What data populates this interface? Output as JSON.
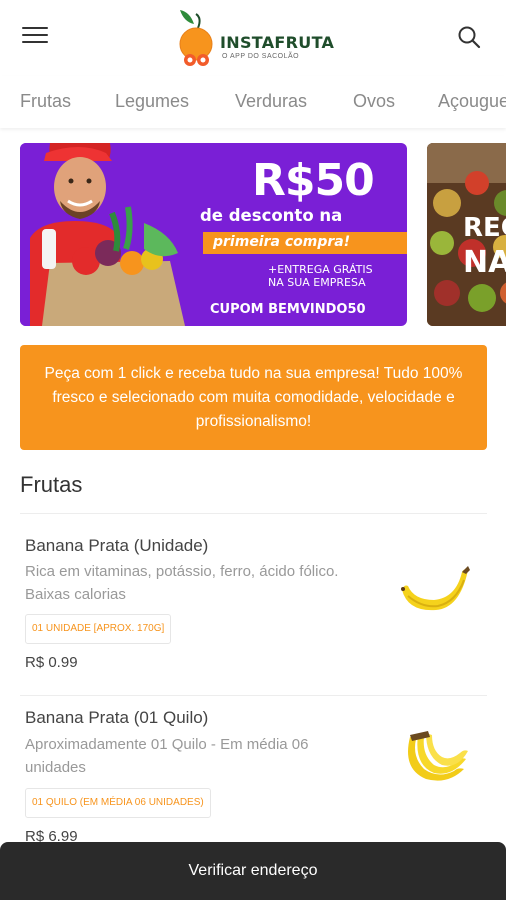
{
  "header": {
    "logo_name": "INSTAFRUTA",
    "logo_tagline": "O APP DO SACOLÃO",
    "menu_icon": "hamburger-menu-icon",
    "search_icon": "search-icon"
  },
  "tabs": [
    "Frutas",
    "Legumes",
    "Verduras",
    "Ovos",
    "Açougue"
  ],
  "banner": {
    "amount": "R$50",
    "line1": "de desconto na",
    "line2": "primeira compra!",
    "line3": "+ENTREGA GRÁTIS",
    "line4": "NA SUA EMPRESA",
    "coupon": "CUPOM BEMVINDO50",
    "brand_color": "#7a1fd6",
    "accent_color": "#f7941d"
  },
  "banner2": {
    "line1": "REC",
    "line2": "NA"
  },
  "promo": {
    "text": "Peça com 1 click e receba tudo na sua empresa! Tudo 100% fresco e selecionado com muita comodidade, velocidade e profissionalismo!"
  },
  "section": {
    "title": "Frutas"
  },
  "products": [
    {
      "name": "Banana Prata (Unidade)",
      "description": "Rica em vitaminas, potássio, ferro, ácido fólico. Baixas calorias",
      "badge": "01 UNIDADE [APROX. 170G]",
      "price": "R$ 0.99",
      "image_icon": "banana-icon"
    },
    {
      "name": "Banana Prata (01 Quilo)",
      "description": "Aproximadamente 01 Quilo - Em média 06 unidades",
      "badge": "01 QUILO (EM MÉDIA 06 UNIDADES)",
      "price": "R$ 6.99",
      "image_icon": "banana-bunch-icon"
    }
  ],
  "bottom_bar": {
    "label": "Verificar endereço"
  }
}
